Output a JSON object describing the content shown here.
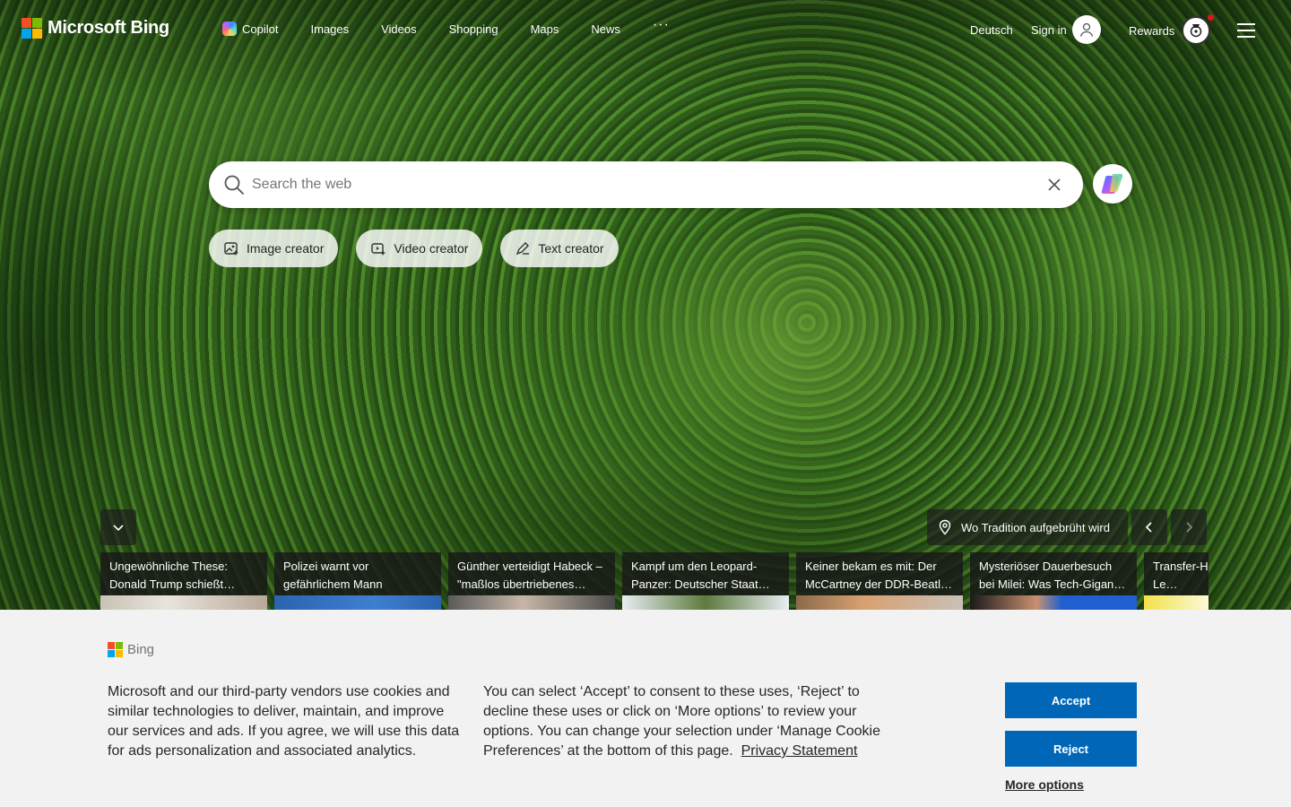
{
  "brand": {
    "name": "Microsoft Bing",
    "logo_colors": [
      "#f25022",
      "#7fba00",
      "#00a4ef",
      "#ffb900"
    ]
  },
  "nav": {
    "items": [
      {
        "label": "Copilot",
        "icon": "copilot-icon"
      },
      {
        "label": "Images"
      },
      {
        "label": "Videos"
      },
      {
        "label": "Shopping"
      },
      {
        "label": "Maps"
      },
      {
        "label": "News"
      }
    ],
    "more": "···"
  },
  "header_right": {
    "language": "Deutsch",
    "signin": "Sign in",
    "rewards": "Rewards"
  },
  "search": {
    "placeholder": "Search the web"
  },
  "chips": [
    {
      "label": "Image creator",
      "icon": "image-creator-icon"
    },
    {
      "label": "Video creator",
      "icon": "video-creator-icon"
    },
    {
      "label": "Text creator",
      "icon": "text-creator-icon"
    }
  ],
  "image_info": {
    "location_label": "Wo Tradition aufgebrüht wird"
  },
  "news": [
    {
      "text": "Ungewöhnliche These: Donald Trump schießt…"
    },
    {
      "text": "Polizei warnt vor gefährlichem Mann"
    },
    {
      "text": "Günther verteidigt Habeck – \"maßlos übertriebenes…"
    },
    {
      "text": "Kampf um den Leopard-Panzer: Deutscher Staat…"
    },
    {
      "text": "Keiner bekam es mit: Der McCartney der DDR-Beatl…"
    },
    {
      "text": "Mysteriöser Dauerbesuch bei Milei: Was Tech-Gigan…"
    },
    {
      "text": "Transfer-Hammer: Europa-Le…"
    }
  ],
  "cookie": {
    "brand": "Bing",
    "text1": "Microsoft and our third-party vendors use cookies and similar technologies to deliver, maintain, and improve our services and ads. If you agree, we will use this data for ads personalization and associated analytics.",
    "text2": "You can select ‘Accept’ to consent to these uses, ‘Reject’ to decline these uses or click on ‘More options’ to review your options. You can change your selection under ‘Manage Cookie Preferences’ at the bottom of this page.",
    "privacy_link": "Privacy Statement",
    "accept": "Accept",
    "reject": "Reject",
    "more_options": "More options",
    "button_color": "#0067b8"
  }
}
